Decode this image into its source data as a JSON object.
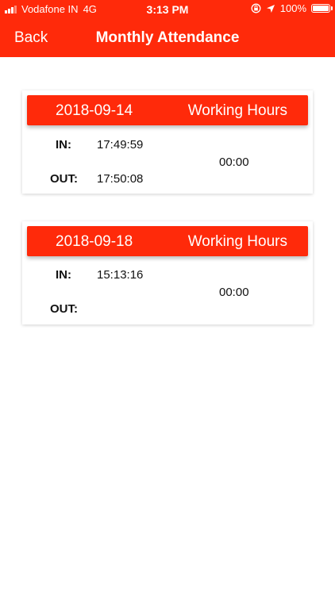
{
  "status_bar": {
    "carrier": "Vodafone IN",
    "network": "4G",
    "time": "3:13 PM",
    "battery_percent": "100%",
    "battery_level": 1.0
  },
  "nav": {
    "back_label": "Back",
    "title": "Monthly Attendance"
  },
  "colors": {
    "accent": "#ff2a0a"
  },
  "records": [
    {
      "date": "2018-09-14",
      "working_hours_label": "Working Hours",
      "in_label": "IN:",
      "in_time": "17:49:59",
      "out_label": "OUT:",
      "out_time": "17:50:08",
      "working_hours": "00:00"
    },
    {
      "date": "2018-09-18",
      "working_hours_label": "Working Hours",
      "in_label": "IN:",
      "in_time": "15:13:16",
      "out_label": "OUT:",
      "out_time": "",
      "working_hours": "00:00"
    }
  ]
}
